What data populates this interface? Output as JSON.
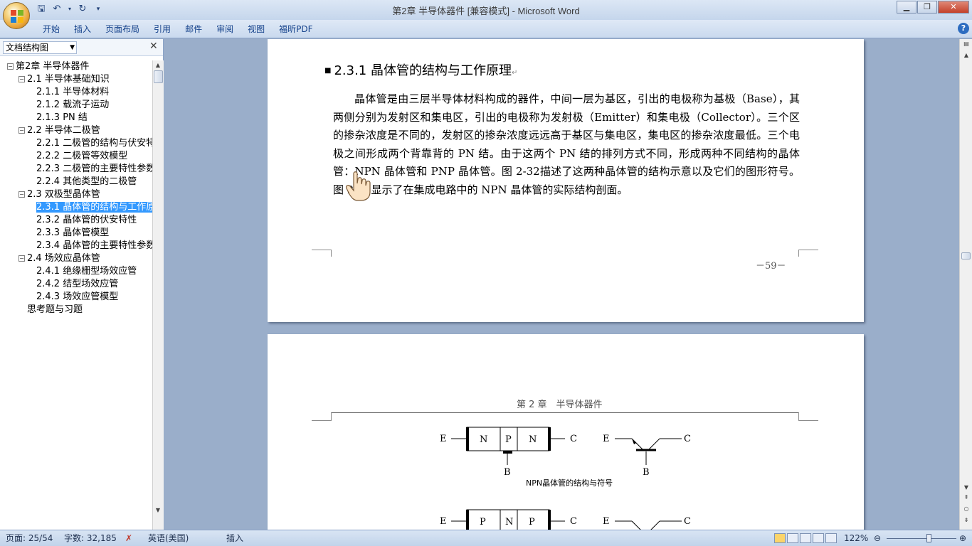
{
  "window": {
    "title": "第2章 半导体器件 [兼容模式] - Microsoft Word",
    "controls": [
      "minimize",
      "restore",
      "close"
    ]
  },
  "quick_access": [
    "save-icon",
    "undo-icon",
    "redo-icon",
    "customize-icon"
  ],
  "ribbon": {
    "tabs": [
      {
        "label": "开始"
      },
      {
        "label": "插入"
      },
      {
        "label": "页面布局"
      },
      {
        "label": "引用"
      },
      {
        "label": "邮件"
      },
      {
        "label": "审阅"
      },
      {
        "label": "视图"
      },
      {
        "label": "福昕PDF"
      }
    ]
  },
  "nav": {
    "mode": "文档结构图",
    "items": [
      {
        "label": "第2章  半导体器件",
        "toggle": "⊟"
      },
      {
        "label": "2.1 半导体基础知识",
        "toggle": "⊟"
      },
      {
        "label": "2.1.1 半导体材料",
        "toggle": ""
      },
      {
        "label": "2.1.2 载流子运动",
        "toggle": ""
      },
      {
        "label": "2.1.3 PN 结",
        "toggle": ""
      },
      {
        "label": "2.2 半导体二极管",
        "toggle": "⊟"
      },
      {
        "label": "2.2.1 二极管的结构与伏安特",
        "toggle": ""
      },
      {
        "label": "2.2.2 二极管等效模型",
        "toggle": ""
      },
      {
        "label": "2.2.3 二极管的主要特性参数",
        "toggle": ""
      },
      {
        "label": "2.2.4 其他类型的二极管",
        "toggle": ""
      },
      {
        "label": "2.3 双极型晶体管",
        "toggle": "⊟"
      },
      {
        "label": "2.3.1 晶体管的结构与工作原",
        "toggle": "",
        "selected": true
      },
      {
        "label": "2.3.2 晶体管的伏安特性",
        "toggle": ""
      },
      {
        "label": "2.3.3 晶体管模型",
        "toggle": ""
      },
      {
        "label": "2.3.4 晶体管的主要特性参数",
        "toggle": ""
      },
      {
        "label": "2.4 场效应晶体管",
        "toggle": "⊟"
      },
      {
        "label": "2.4.1 绝缘栅型场效应管",
        "toggle": ""
      },
      {
        "label": "2.4.2 结型场效应管",
        "toggle": ""
      },
      {
        "label": "2.4.3 场效应管模型",
        "toggle": ""
      },
      {
        "label": "思考题与习题",
        "toggle": ""
      }
    ]
  },
  "page1": {
    "heading": "2.3.1  晶体管的结构与工作原理",
    "paragraph": "晶体管是由三层半导体材料构成的器件，中间一层为基区，引出的电极称为基极（Base），其两侧分别为发射区和集电区，引出的电极称为发射极（Emitter）和集电极（Collector）。三个区的掺杂浓度是不同的，发射区的掺杂浓度远远高于基区与集电区，集电区的掺杂浓度最低。三个电极之间形成两个背靠背的 PN 结。由于这两个 PN 结的排列方式不同，形成两种不同结构的晶体管：NPN 晶体管和 PNP 晶体管。图 2-32描述了这两种晶体管的结构示意以及它们的图形符号。图 2-33显示了在集成电路中的 NPN 晶体管的实际结构剖面。",
    "page_number": "－59－"
  },
  "page2": {
    "header": "第 2 章　半导体器件",
    "npn_caption": "NPN晶体管的结构与符号",
    "labels": {
      "E": "E",
      "C": "C",
      "B": "B",
      "N": "N",
      "P": "P"
    }
  },
  "status": {
    "page": "页面: 25/54",
    "words": "字数: 32,185",
    "language": "英语(美国)",
    "mode": "插入",
    "zoom": "122%",
    "zoom_level": 0.61
  }
}
